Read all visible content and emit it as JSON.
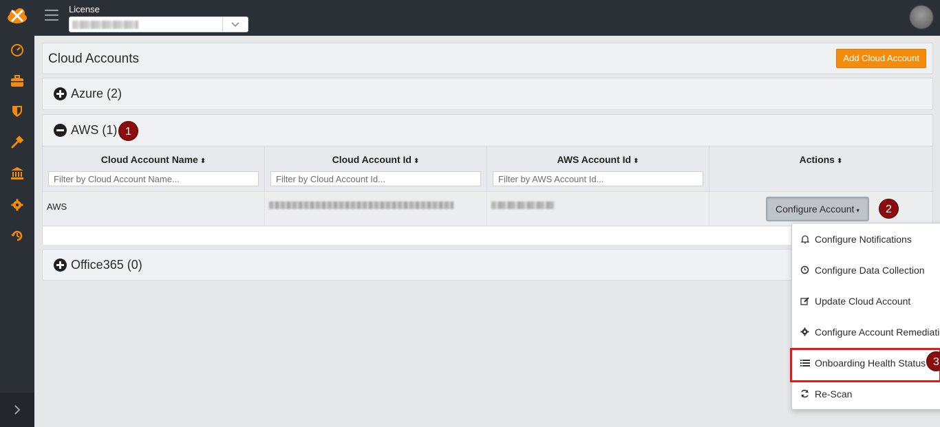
{
  "header": {
    "license_label": "License",
    "license_value": "",
    "license_chevron": "⌄"
  },
  "sidebar": {
    "items": [
      {
        "icon": "speedometer-icon"
      },
      {
        "icon": "briefcase-icon"
      },
      {
        "icon": "shield-icon"
      },
      {
        "icon": "hammer-icon"
      },
      {
        "icon": "bank-icon"
      },
      {
        "icon": "gear-icon"
      },
      {
        "icon": "history-icon"
      }
    ],
    "expand_icon": "chevron-right-icon"
  },
  "page": {
    "title": "Cloud Accounts",
    "add_button": "Add Cloud Account"
  },
  "groups": {
    "azure": {
      "label": "Azure (2)"
    },
    "aws": {
      "label": "AWS (1)"
    },
    "office365": {
      "label": "Office365 (0)"
    }
  },
  "table": {
    "columns": [
      {
        "label": "Cloud Account Name",
        "filter_placeholder": "Filter by Cloud Account Name..."
      },
      {
        "label": "Cloud Account Id",
        "filter_placeholder": "Filter by Cloud Account Id..."
      },
      {
        "label": "AWS Account Id",
        "filter_placeholder": "Filter by AWS Account Id..."
      },
      {
        "label": "Actions"
      }
    ],
    "sort_glyph": "⬍",
    "rows": [
      {
        "name": "AWS",
        "cloud_account_id": "",
        "aws_account_id": "",
        "action_label": "Configure Account",
        "action_caret": "▾"
      }
    ]
  },
  "dropdown": {
    "items": [
      {
        "label": "Configure Notifications",
        "icon": "bell-icon"
      },
      {
        "label": "Configure Data Collection",
        "icon": "clock-icon"
      },
      {
        "label": "Update Cloud Account",
        "icon": "edit-icon"
      },
      {
        "label": "Configure Account Remediation",
        "icon": "gear-icon"
      },
      {
        "label": "Onboarding Health Status",
        "icon": "list-icon"
      },
      {
        "label": "Re-Scan",
        "icon": "refresh-icon"
      }
    ]
  },
  "annotations": {
    "badge1": "1",
    "badge2": "2",
    "badge3": "3"
  },
  "colors": {
    "accent": "#f48b0c",
    "sidebar_icon": "#f48b0c",
    "badge": "#8b0d0d",
    "highlight": "#e01a1a"
  }
}
